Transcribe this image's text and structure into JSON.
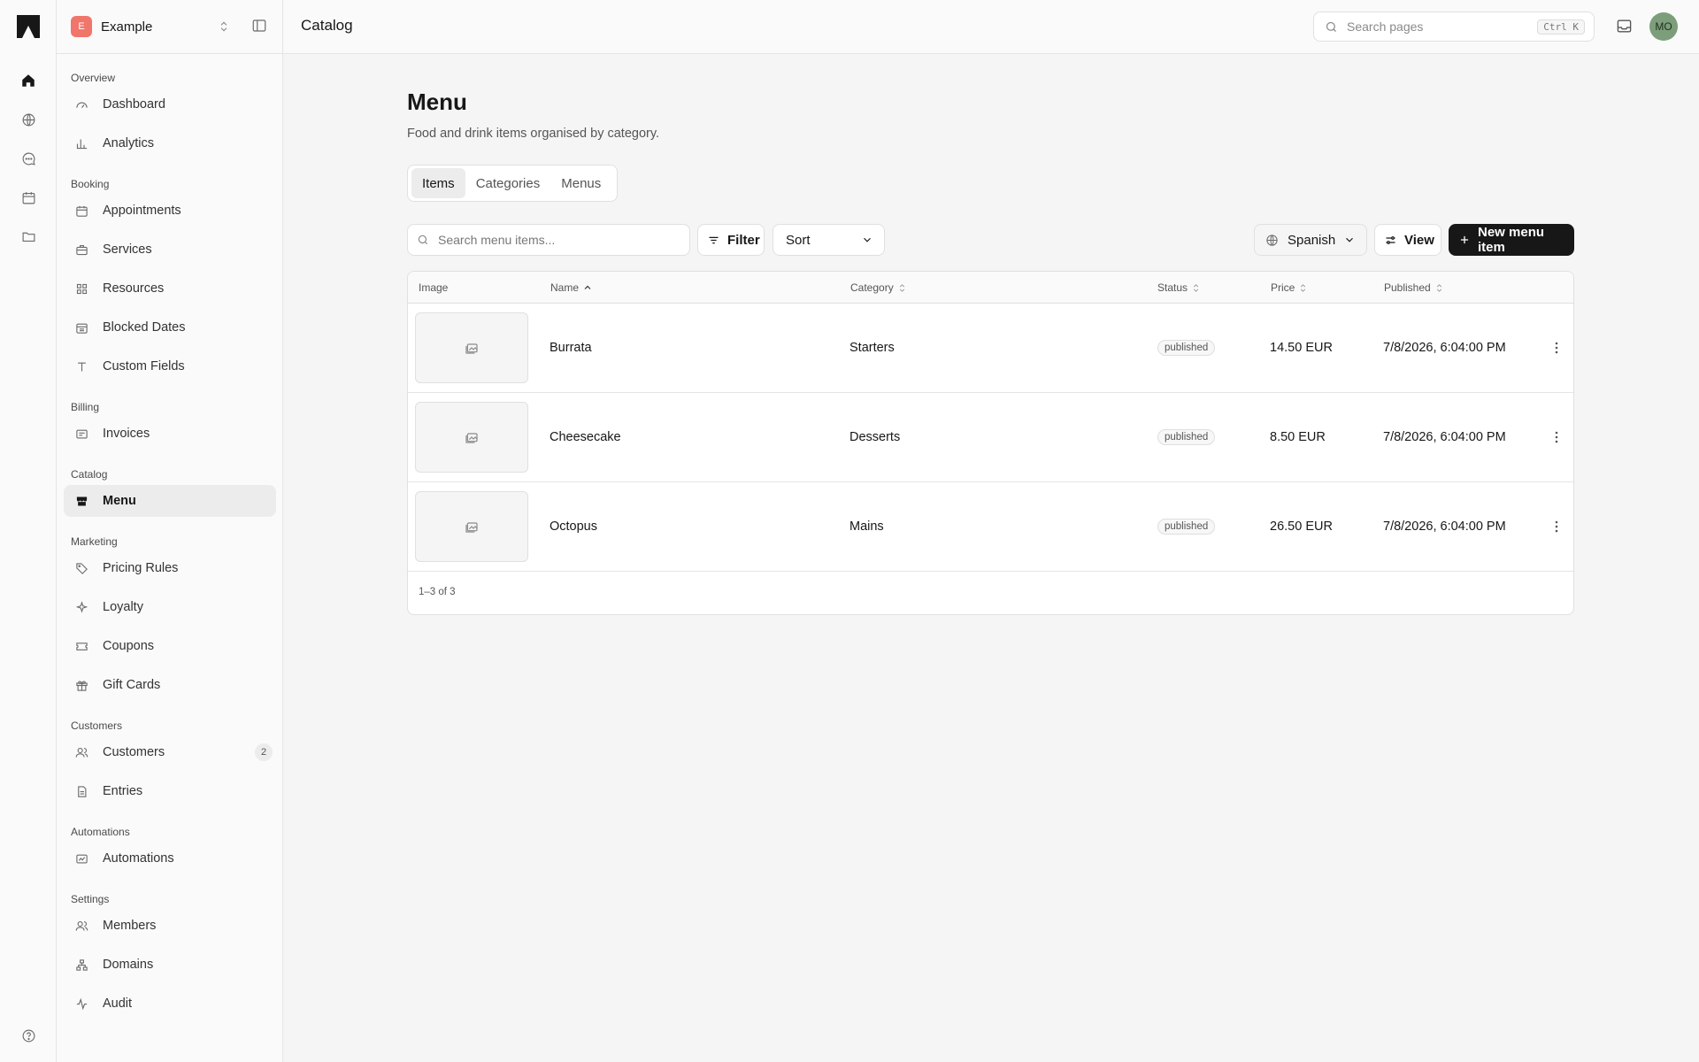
{
  "workspace": {
    "initial": "E",
    "name": "Example"
  },
  "topbar": {
    "title": "Catalog",
    "search_placeholder": "Search pages",
    "shortcut": "Ctrl K",
    "user_initials": "MO"
  },
  "sidebar": {
    "groups": [
      {
        "label": "Overview",
        "items": [
          {
            "label": "Dashboard",
            "icon": "gauge-icon"
          },
          {
            "label": "Analytics",
            "icon": "bar-chart-icon"
          }
        ]
      },
      {
        "label": "Booking",
        "items": [
          {
            "label": "Appointments",
            "icon": "calendar-icon"
          },
          {
            "label": "Services",
            "icon": "briefcase-icon"
          },
          {
            "label": "Resources",
            "icon": "grid-icon"
          },
          {
            "label": "Blocked Dates",
            "icon": "calendar-x-icon"
          },
          {
            "label": "Custom Fields",
            "icon": "text-icon"
          }
        ]
      },
      {
        "label": "Billing",
        "items": [
          {
            "label": "Invoices",
            "icon": "receipt-icon"
          }
        ]
      },
      {
        "label": "Catalog",
        "items": [
          {
            "label": "Menu",
            "icon": "store-icon",
            "active": true
          }
        ]
      },
      {
        "label": "Marketing",
        "items": [
          {
            "label": "Pricing Rules",
            "icon": "tag-icon"
          },
          {
            "label": "Loyalty",
            "icon": "sparkles-icon"
          },
          {
            "label": "Coupons",
            "icon": "ticket-icon"
          },
          {
            "label": "Gift Cards",
            "icon": "gift-icon"
          }
        ]
      },
      {
        "label": "Customers",
        "items": [
          {
            "label": "Customers",
            "icon": "users-icon",
            "badge": "2"
          },
          {
            "label": "Entries",
            "icon": "file-icon"
          }
        ]
      },
      {
        "label": "Automations",
        "items": [
          {
            "label": "Automations",
            "icon": "workflow-icon"
          }
        ]
      },
      {
        "label": "Settings",
        "items": [
          {
            "label": "Members",
            "icon": "users-icon"
          },
          {
            "label": "Domains",
            "icon": "network-icon"
          },
          {
            "label": "Audit",
            "icon": "activity-icon"
          }
        ]
      }
    ]
  },
  "page": {
    "title": "Menu",
    "subtitle": "Food and drink items organised by category.",
    "tabs": [
      {
        "label": "Items",
        "active": true
      },
      {
        "label": "Categories"
      },
      {
        "label": "Menus"
      }
    ]
  },
  "toolbar": {
    "search_placeholder": "Search menu items...",
    "filter_label": "Filter",
    "sort_label": "Sort",
    "language_label": "Spanish",
    "view_label": "View",
    "new_label": "New menu item"
  },
  "table": {
    "columns": {
      "image": "Image",
      "name": "Name",
      "category": "Category",
      "status": "Status",
      "price": "Price",
      "published": "Published"
    },
    "rows": [
      {
        "name": "Burrata",
        "category": "Starters",
        "status": "published",
        "price": "14.50 EUR",
        "published": "7/8/2026, 6:04:00 PM"
      },
      {
        "name": "Cheesecake",
        "category": "Desserts",
        "status": "published",
        "price": "8.50 EUR",
        "published": "7/8/2026, 6:04:00 PM"
      },
      {
        "name": "Octopus",
        "category": "Mains",
        "status": "published",
        "price": "26.50 EUR",
        "published": "7/8/2026, 6:04:00 PM"
      }
    ],
    "footer": "1–3 of 3"
  }
}
